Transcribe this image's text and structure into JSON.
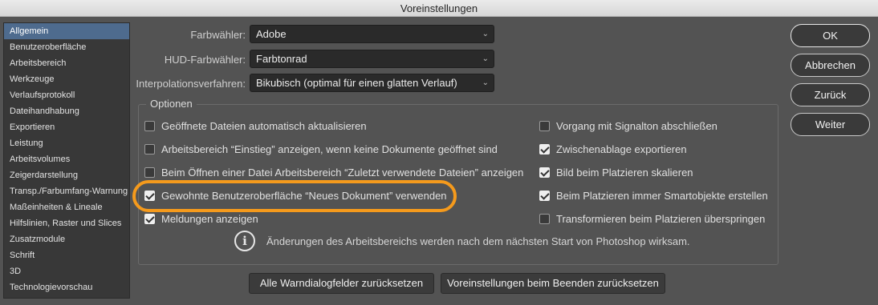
{
  "window": {
    "title": "Voreinstellungen"
  },
  "sidebar": {
    "items": [
      {
        "label": "Allgemein",
        "selected": true
      },
      {
        "label": "Benutzeroberfläche"
      },
      {
        "label": "Arbeitsbereich"
      },
      {
        "label": "Werkzeuge"
      },
      {
        "label": "Verlaufsprotokoll"
      },
      {
        "label": "Dateihandhabung"
      },
      {
        "label": "Exportieren"
      },
      {
        "label": "Leistung"
      },
      {
        "label": "Arbeitsvolumes"
      },
      {
        "label": "Zeigerdarstellung"
      },
      {
        "label": "Transp./Farbumfang-Warnung"
      },
      {
        "label": "Maßeinheiten & Lineale"
      },
      {
        "label": "Hilfslinien, Raster und Slices"
      },
      {
        "label": "Zusatzmodule"
      },
      {
        "label": "Schrift"
      },
      {
        "label": "3D"
      },
      {
        "label": "Technologievorschau"
      }
    ]
  },
  "settings": {
    "farbwaehler": {
      "label": "Farbwähler:",
      "value": "Adobe"
    },
    "hud_farbwaehler": {
      "label": "HUD-Farbwähler:",
      "value": "Farbtonrad"
    },
    "interpolation": {
      "label": "Interpolationsverfahren:",
      "value": "Bikubisch (optimal für einen glatten Verlauf)"
    }
  },
  "options": {
    "title": "Optionen",
    "left": [
      {
        "label": "Geöffnete Dateien automatisch aktualisieren",
        "checked": false
      },
      {
        "label": "Arbeitsbereich “Einstieg” anzeigen, wenn keine Dokumente geöffnet sind",
        "checked": false
      },
      {
        "label": "Beim Öffnen einer Datei Arbeitsbereich “Zuletzt verwendete Dateien” anzeigen",
        "checked": false
      },
      {
        "label": "Gewohnte Benutzeroberfläche “Neues Dokument” verwenden",
        "checked": true
      },
      {
        "label": "Meldungen anzeigen",
        "checked": true
      }
    ],
    "right": [
      {
        "label": "Vorgang mit Signalton abschließen",
        "checked": false
      },
      {
        "label": "Zwischenablage exportieren",
        "checked": true
      },
      {
        "label": "Bild beim Platzieren skalieren",
        "checked": true
      },
      {
        "label": "Beim Platzieren immer Smartobjekte erstellen",
        "checked": true
      },
      {
        "label": "Transformieren beim Platzieren überspringen",
        "checked": false
      }
    ],
    "info_text": "Änderungen des Arbeitsbereichs werden nach dem nächsten Start von Photoshop wirksam."
  },
  "bottom_buttons": {
    "reset_warnings": "Alle Warndialogfelder zurücksetzen",
    "reset_prefs": "Voreinstellungen beim Beenden zurücksetzen"
  },
  "right_buttons": {
    "ok": "OK",
    "cancel": "Abbrechen",
    "back": "Zurück",
    "next": "Weiter"
  },
  "colors": {
    "highlight": "#f59a1c",
    "selected": "#4e6b8e"
  }
}
